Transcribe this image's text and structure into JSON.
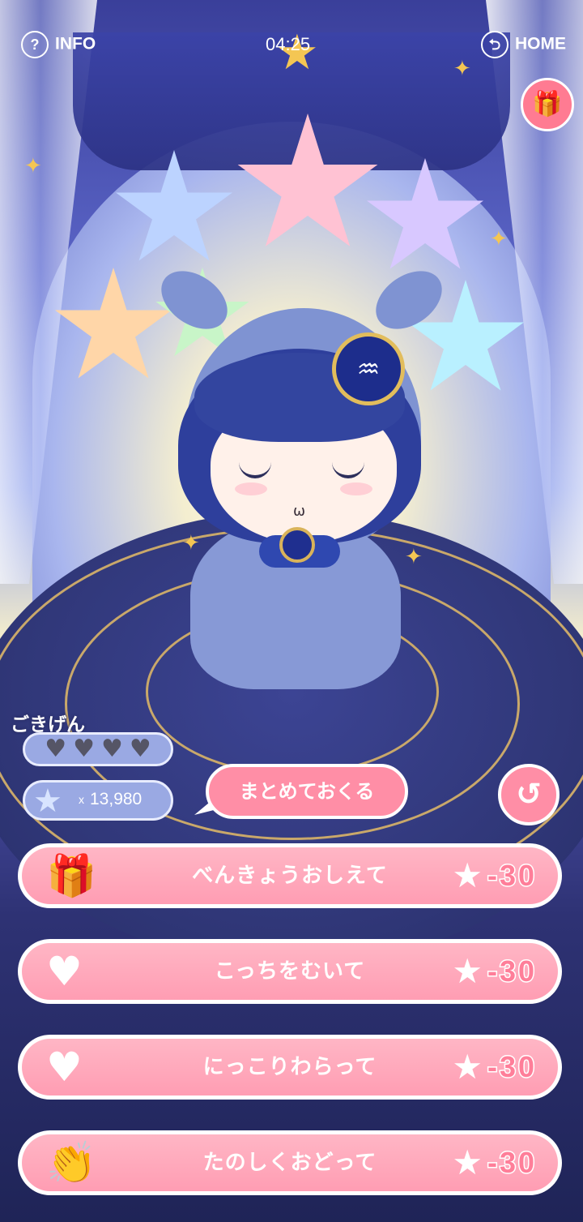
{
  "header": {
    "info_label": "INFO",
    "info_icon": "?",
    "clock": "04:25",
    "home_label": "HOME",
    "home_icon": "⮌"
  },
  "status": {
    "mood_label": "ごきげん",
    "hearts_filled": 0,
    "hearts_total": 4,
    "coins_multiplier": "x",
    "coins_value": "13,980"
  },
  "bulk_send_label": "まとめておくる",
  "actions": [
    {
      "label": "べんきょうおしえて",
      "icon": "gift-icon",
      "cost": "-30"
    },
    {
      "label": "こっちをむいて",
      "icon": "heart-icon",
      "cost": "-30"
    },
    {
      "label": "にっこりわらって",
      "icon": "heart-icon",
      "cost": "-30"
    },
    {
      "label": "たのしくおどって",
      "icon": "clap-hands-icon",
      "cost": "-30"
    }
  ],
  "colors": {
    "accent_pink": "#ff8ea6",
    "cost_text": "#ff7e99",
    "pill_blue": "#9aa9e3",
    "stage_navy": "#2e3274"
  }
}
